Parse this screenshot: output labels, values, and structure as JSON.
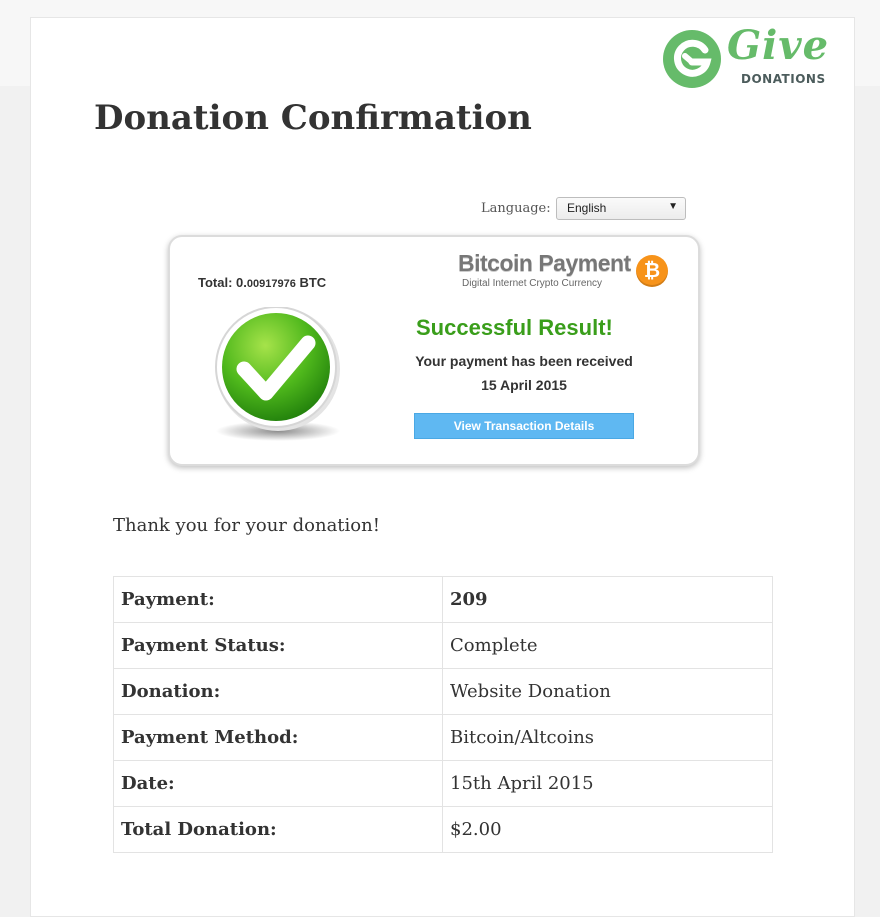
{
  "brand": {
    "logo_word": "Give",
    "logo_sub": "DONATIONS",
    "logo_color": "#66bb6a"
  },
  "page": {
    "title": "Donation Confirmation"
  },
  "language": {
    "label": "Language:",
    "selected": "English"
  },
  "payment_card": {
    "total_label": "Total:",
    "total_amount_int": "0.",
    "total_amount_dec": "00917976",
    "total_currency": "BTC",
    "brand_title": "Bitcoin Payment",
    "brand_subtitle": "Digital Internet Crypto Currency",
    "coin_symbol": "₿",
    "result_title": "Successful Result!",
    "received_text": "Your payment has been received",
    "received_date": "15 April 2015",
    "details_button": "View Transaction Details",
    "success_color": "#3a9e1b",
    "coin_color": "#f7931a"
  },
  "thanks_text": "Thank you for your donation!",
  "details": [
    {
      "label": "Payment:",
      "value": "209"
    },
    {
      "label": "Payment Status:",
      "value": "Complete"
    },
    {
      "label": "Donation:",
      "value": "Website Donation"
    },
    {
      "label": "Payment Method:",
      "value": "Bitcoin/Altcoins"
    },
    {
      "label": "Date:",
      "value": "15th April 2015"
    },
    {
      "label": "Total Donation:",
      "value": "$2.00"
    }
  ]
}
